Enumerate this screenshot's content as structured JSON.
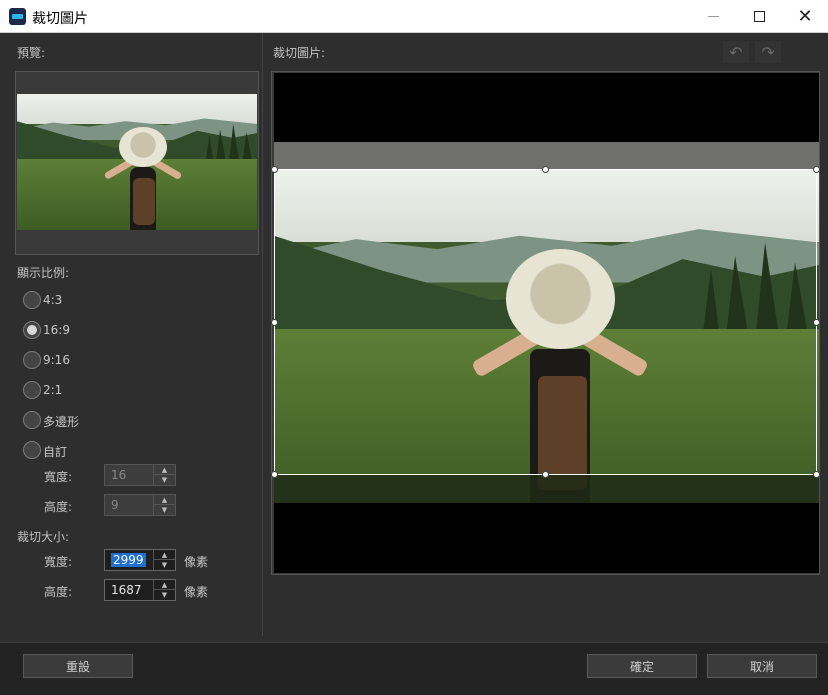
{
  "window": {
    "title": "裁切圖片"
  },
  "left": {
    "preview_label": "預覽:",
    "ratio_label": "顯示比例:",
    "ratios": [
      {
        "label": "4:3",
        "checked": false
      },
      {
        "label": "16:9",
        "checked": true
      },
      {
        "label": "9:16",
        "checked": false
      },
      {
        "label": "2:1",
        "checked": false
      },
      {
        "label": "多邊形",
        "checked": false
      },
      {
        "label": "自訂",
        "checked": false
      }
    ],
    "custom": {
      "width_label": "寬度:",
      "width_value": "16",
      "height_label": "高度:",
      "height_value": "9"
    },
    "crop_size_label": "裁切大小:",
    "crop": {
      "width_label": "寬度:",
      "width_value": "2999",
      "height_label": "高度:",
      "height_value": "1687",
      "unit": "像素"
    }
  },
  "right": {
    "crop_label": "裁切圖片:"
  },
  "buttons": {
    "reset": "重設",
    "ok": "確定",
    "cancel": "取消"
  },
  "icons": {
    "undo": "undo-icon",
    "redo": "redo-icon"
  },
  "colors": {
    "selection": "#1e6fd0",
    "background": "#2e2e2e"
  }
}
